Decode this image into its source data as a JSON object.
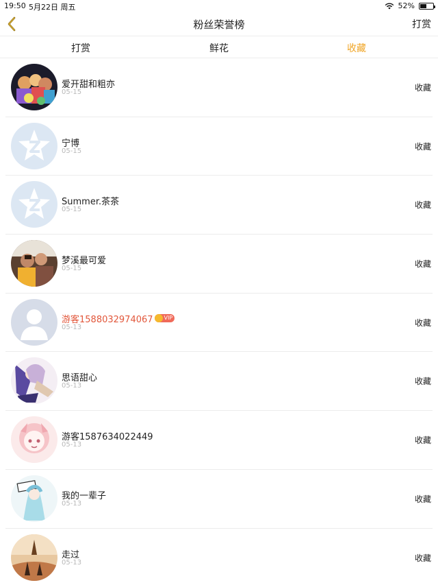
{
  "status_bar": {
    "time": "19:50",
    "date": "5月22日 周五",
    "battery": "52%",
    "battery_level": 0.52
  },
  "nav": {
    "title": "粉丝荣誉榜",
    "action": "打赏"
  },
  "colors": {
    "accent": "#f0a526",
    "vip_name": "#e2573b",
    "muted": "#b8b8b8"
  },
  "tabs": [
    {
      "label": "打赏",
      "active": false
    },
    {
      "label": "鲜花",
      "active": false
    },
    {
      "label": "收藏",
      "active": true
    }
  ],
  "fans": [
    {
      "name": "爱开甜和粗亦",
      "date": "05-15",
      "action": "收藏",
      "avatar": "photo-group"
    },
    {
      "name": "宁博",
      "date": "05-15",
      "action": "收藏",
      "avatar": "qq-default"
    },
    {
      "name": "Summer.茶茶",
      "date": "05-15",
      "action": "收藏",
      "avatar": "qq-default"
    },
    {
      "name": "梦溪最可爱",
      "date": "05-15",
      "action": "收藏",
      "avatar": "photo-people"
    },
    {
      "name": "游客1588032974067",
      "date": "05-13",
      "action": "收藏",
      "avatar": "person-default",
      "vip": true,
      "vip_label": "VIP"
    },
    {
      "name": "思语甜心",
      "date": "05-13",
      "action": "收藏",
      "avatar": "anime-purple"
    },
    {
      "name": "游客1587634022449",
      "date": "05-13",
      "action": "收藏",
      "avatar": "anime-pink"
    },
    {
      "name": "我的一辈子",
      "date": "05-13",
      "action": "收藏",
      "avatar": "anime-blue"
    },
    {
      "name": "走过",
      "date": "05-13",
      "action": "收藏",
      "avatar": "photo-sunset"
    }
  ]
}
